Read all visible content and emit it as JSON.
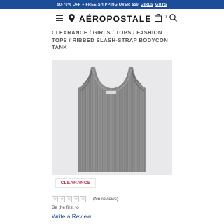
{
  "promo": {
    "text": "50-70% OFF + FREE SHIPPING OVER $50",
    "links": [
      "GIRLS",
      "GUYS"
    ]
  },
  "header": {
    "logo": "AÉROPOSTALE",
    "bag_count": "0",
    "icons": [
      "menu-icon",
      "location-pin-icon",
      "shopping-bag-icon",
      "search-icon"
    ]
  },
  "breadcrumb": "CLEARANCE / GIRLS / TOPS / FASHION TOPS / RIBBED SLASH-STRAP BODYCON TANK",
  "product": {
    "badge": "CLEARANCE",
    "color": "#8e8e8e"
  },
  "rating": {
    "value": 0,
    "max": 5,
    "reviews_text": "(No reviews)",
    "first_text": "Be the first to",
    "write_link": "Write a Review"
  },
  "colors": {
    "promo_bg": "#1b4d9a",
    "badge_text": "#b32d45",
    "link": "#1b4d9a"
  }
}
